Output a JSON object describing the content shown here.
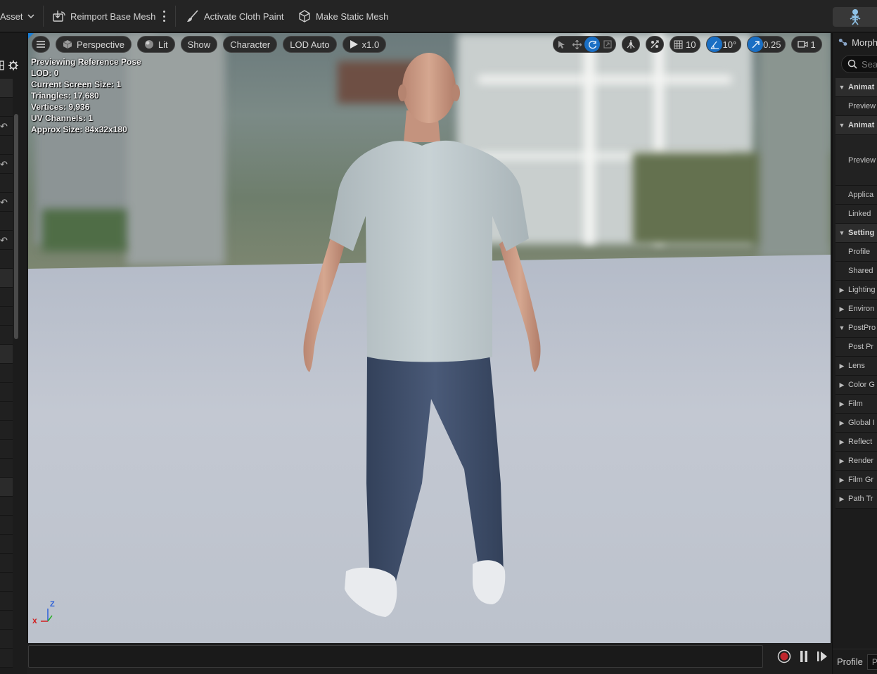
{
  "toolbar": {
    "asset_label": "Asset",
    "reimport_label": "Reimport Base Mesh",
    "cloth_paint_label": "Activate Cloth Paint",
    "static_mesh_label": "Make Static Mesh"
  },
  "viewport": {
    "view_mode": "Perspective",
    "lighting": "Lit",
    "show": "Show",
    "character": "Character",
    "lod": "LOD Auto",
    "speed": "x1.0",
    "grid_snap": "10",
    "rotation_snap": "10°",
    "scale_snap": "0.25",
    "camera_speed": "1",
    "axis_x": "x",
    "axis_z": "Z",
    "info": [
      "Previewing Reference Pose",
      "LOD: 0",
      "Current Screen Size: 1",
      "Triangles: 17,680",
      "Vertices: 9,936",
      "UV Channels: 1",
      "Approx Size: 84x32x180"
    ]
  },
  "right_panel": {
    "tab": "Morph",
    "search_placeholder": "Sea",
    "rows": [
      {
        "type": "cat",
        "open": true,
        "label": "Animat"
      },
      {
        "type": "item",
        "label": "Preview"
      },
      {
        "type": "cat",
        "open": true,
        "label": "Animat"
      },
      {
        "type": "tall",
        "label": "Preview"
      },
      {
        "type": "item",
        "label": "Applica"
      },
      {
        "type": "item",
        "label": "Linked"
      },
      {
        "type": "cat",
        "open": true,
        "label": "Setting"
      },
      {
        "type": "item",
        "label": "Profile"
      },
      {
        "type": "item",
        "label": "Shared"
      },
      {
        "type": "group",
        "open": false,
        "label": "Lighting"
      },
      {
        "type": "group",
        "open": false,
        "label": "Environ"
      },
      {
        "type": "group",
        "open": true,
        "label": "PostPro"
      },
      {
        "type": "item",
        "label": "Post Pr"
      },
      {
        "type": "group",
        "open": false,
        "label": "Lens"
      },
      {
        "type": "group",
        "open": false,
        "label": "Color G"
      },
      {
        "type": "group",
        "open": false,
        "label": "Film"
      },
      {
        "type": "group",
        "open": false,
        "label": "Global I"
      },
      {
        "type": "group",
        "open": false,
        "label": "Reflect"
      },
      {
        "type": "group",
        "open": false,
        "label": "Render"
      },
      {
        "type": "group",
        "open": false,
        "label": "Film Gr"
      },
      {
        "type": "group",
        "open": false,
        "label": "Path Tr"
      }
    ],
    "footer_label": "Profile",
    "footer_value": "Pr"
  },
  "colors": {
    "accent": "#1a6fc4",
    "record": "#c0272d",
    "panel_bg": "#1c1c1c",
    "toolbar_bg": "#242424"
  }
}
